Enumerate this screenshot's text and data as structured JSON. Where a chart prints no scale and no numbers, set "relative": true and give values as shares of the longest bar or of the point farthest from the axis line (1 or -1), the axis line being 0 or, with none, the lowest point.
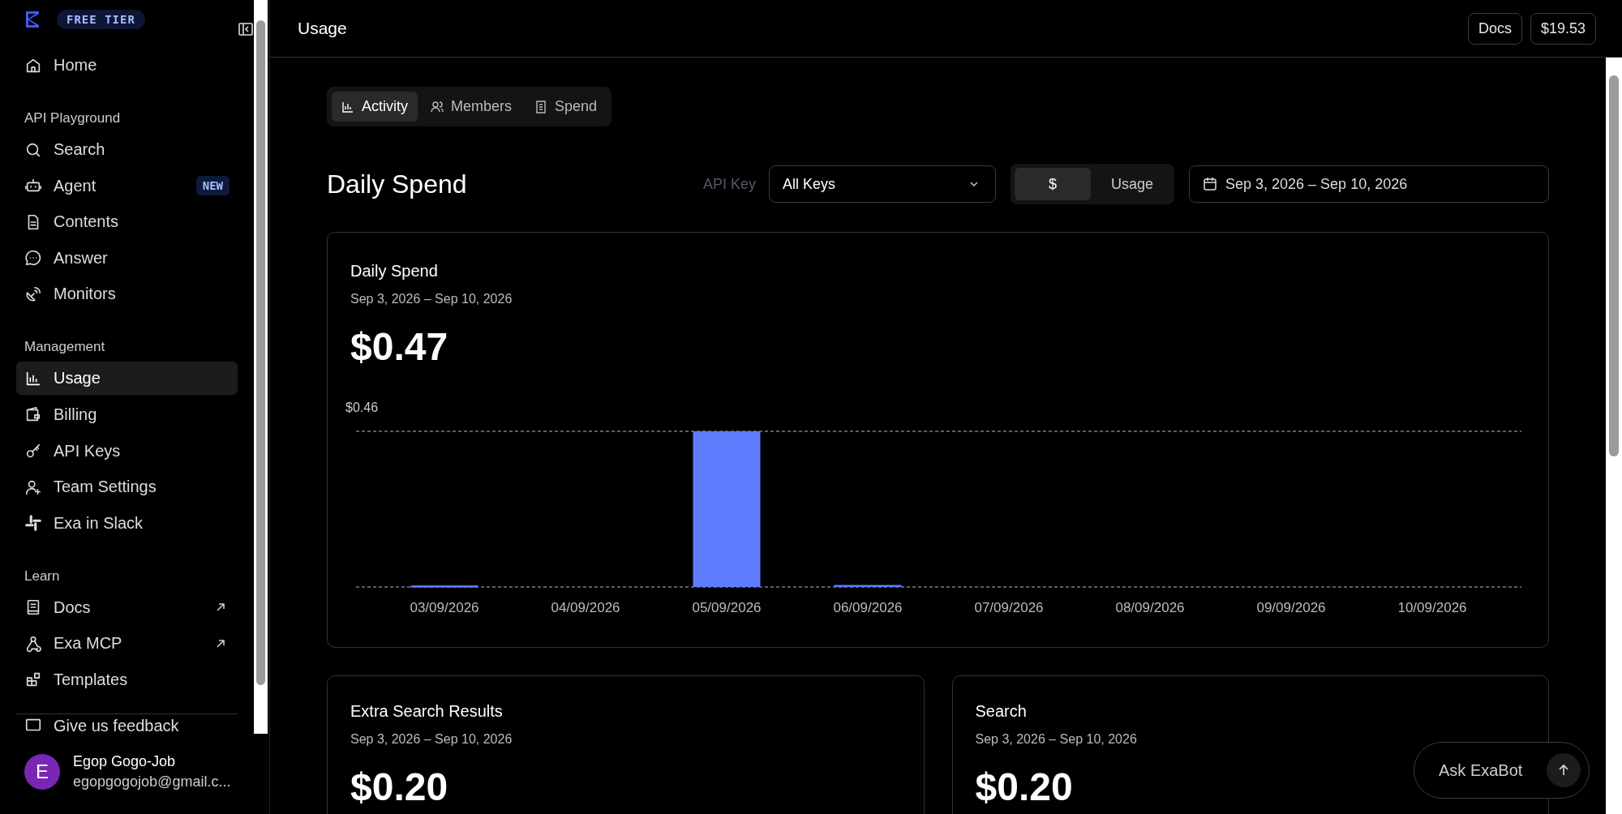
{
  "sidebar": {
    "tier_badge": "FREE TIER",
    "sections": [
      {
        "items": [
          {
            "label": "Home",
            "selected": false
          }
        ]
      },
      {
        "heading": "API Playground",
        "items": [
          {
            "label": "Search",
            "selected": false
          },
          {
            "label": "Agent",
            "selected": false,
            "badge": "NEW"
          },
          {
            "label": "Contents",
            "selected": false
          },
          {
            "label": "Answer",
            "selected": false
          },
          {
            "label": "Monitors",
            "selected": false
          }
        ]
      },
      {
        "heading": "Management",
        "items": [
          {
            "label": "Usage",
            "selected": true
          },
          {
            "label": "Billing",
            "selected": false
          },
          {
            "label": "API Keys",
            "selected": false
          },
          {
            "label": "Team Settings",
            "selected": false
          },
          {
            "label": "Exa in Slack",
            "selected": false
          }
        ]
      },
      {
        "heading": "Learn",
        "items": [
          {
            "label": "Docs",
            "selected": false,
            "external": true
          },
          {
            "label": "Exa MCP",
            "selected": false,
            "external": true
          },
          {
            "label": "Templates",
            "selected": false,
            "external": false
          }
        ]
      }
    ],
    "footer_item": {
      "label": "Give us feedback"
    },
    "user": {
      "initial": "E",
      "name": "Egop Gogo-Job",
      "email": "egopgogojob@gmail.c..."
    }
  },
  "header": {
    "title": "Usage",
    "buttons": [
      "Docs",
      "$19.53"
    ]
  },
  "tabs": [
    {
      "label": "Activity",
      "selected": true
    },
    {
      "label": "Members",
      "selected": false
    },
    {
      "label": "Spend",
      "selected": false
    }
  ],
  "page_title": "Daily Spend",
  "filters": {
    "api_key_label": "API Key",
    "api_key_value": "All Keys",
    "modes": [
      {
        "label": "$",
        "selected": true
      },
      {
        "label": "Usage",
        "selected": false
      }
    ],
    "date_range": "Sep 3, 2026 – Sep 10, 2026"
  },
  "main_card": {
    "title": "Daily Spend",
    "date_range": "Sep 3, 2026 – Sep 10, 2026",
    "total": "$0.47",
    "chart_data": {
      "type": "bar",
      "relative": true,
      "categories": [
        "03/09/2026",
        "04/09/2026",
        "05/09/2026",
        "06/09/2026",
        "07/09/2026",
        "08/09/2026",
        "09/09/2026",
        "10/09/2026"
      ],
      "values": [
        0.01,
        0,
        1,
        0.013,
        0,
        0,
        0,
        0
      ],
      "annotations": [
        "$0.46"
      ]
    }
  },
  "cards": [
    {
      "title": "Extra Search Results",
      "date_range": "Sep 3, 2026 – Sep 10, 2026",
      "total": "$0.20"
    },
    {
      "title": "Search",
      "date_range": "Sep 3, 2026 – Sep 10, 2026",
      "total": "$0.20"
    }
  ],
  "chat": {
    "placeholder": "Ask ExaBot"
  }
}
